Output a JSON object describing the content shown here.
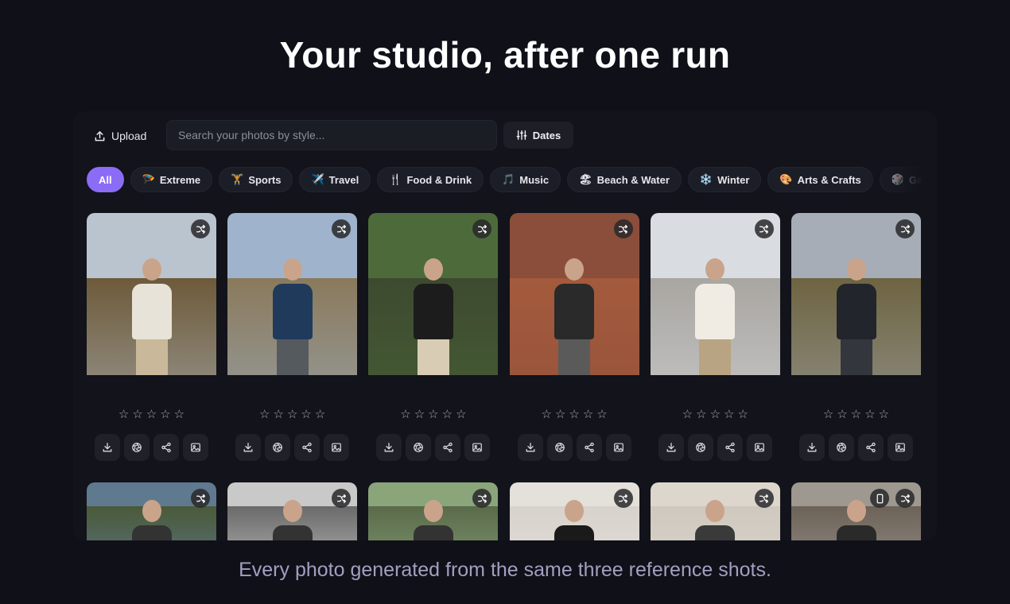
{
  "hero": {
    "title": "Your studio, after one run"
  },
  "toolbar": {
    "upload_label": "Upload",
    "search_placeholder": "Search your photos by style...",
    "dates_label": "Dates"
  },
  "categories": [
    {
      "label": "All",
      "emoji": "",
      "active": true
    },
    {
      "label": "Extreme",
      "emoji": "🪂",
      "active": false
    },
    {
      "label": "Sports",
      "emoji": "🏋",
      "active": false
    },
    {
      "label": "Travel",
      "emoji": "✈️",
      "active": false
    },
    {
      "label": "Food & Drink",
      "emoji": "🍴",
      "active": false
    },
    {
      "label": "Music",
      "emoji": "🎵",
      "active": false
    },
    {
      "label": "Beach & Water",
      "emoji": "🏖",
      "active": false
    },
    {
      "label": "Winter",
      "emoji": "❄️",
      "active": false
    },
    {
      "label": "Arts & Crafts",
      "emoji": "🎨",
      "active": false
    },
    {
      "label": "Games",
      "emoji": "🎲",
      "active": false
    }
  ],
  "photos_row1": [
    {
      "sky": "#b9c4cf",
      "ground": "#6d5a3a",
      "shirt": "#e8e3d8",
      "pants": "#c9b99a"
    },
    {
      "sky": "#9fb4cc",
      "ground": "#8a7a5c",
      "shirt": "#203a5c",
      "pants": "#555a5f"
    },
    {
      "sky": "#4d6b3a",
      "ground": "#3d4a2f",
      "shirt": "#1c1c1c",
      "pants": "#d8cdb4"
    },
    {
      "sky": "#8a4e3a",
      "ground": "#a45a3c",
      "shirt": "#2a2a2a",
      "pants": "#5a5a5a"
    },
    {
      "sky": "#d9dde2",
      "ground": "#a9a6a1",
      "shirt": "#f0ece4",
      "pants": "#b8a482"
    },
    {
      "sky": "#a7adb7",
      "ground": "#6e6441",
      "shirt": "#22252b",
      "pants": "#33363c"
    }
  ],
  "photos_row2": [
    {
      "sky": "#5f7a8f",
      "ground": "#4a5a3a",
      "shirt": "#333",
      "pants": "#333"
    },
    {
      "sky": "#c9c9c9",
      "ground": "#6a6a6a",
      "shirt": "#333",
      "pants": "#333"
    },
    {
      "sky": "#8aa57a",
      "ground": "#5a6a4a",
      "shirt": "#333",
      "pants": "#333"
    },
    {
      "sky": "#e4e0da",
      "ground": "#d7d2cb",
      "shirt": "#1a1a1a",
      "pants": "#333"
    },
    {
      "sky": "#dcd6cd",
      "ground": "#cfc8be",
      "shirt": "#3a3a3a",
      "pants": "#333"
    },
    {
      "sky": "#9e9890",
      "ground": "#6c6258",
      "shirt": "#2a2a2a",
      "pants": "#333"
    }
  ],
  "icons": {
    "shuffle": "shuffle-icon",
    "star": "star-outline-icon",
    "actions": [
      "download-icon",
      "aperture-icon",
      "share-icon",
      "image-icon"
    ]
  },
  "footer": {
    "subtitle": "Every photo generated from the same three reference shots."
  }
}
